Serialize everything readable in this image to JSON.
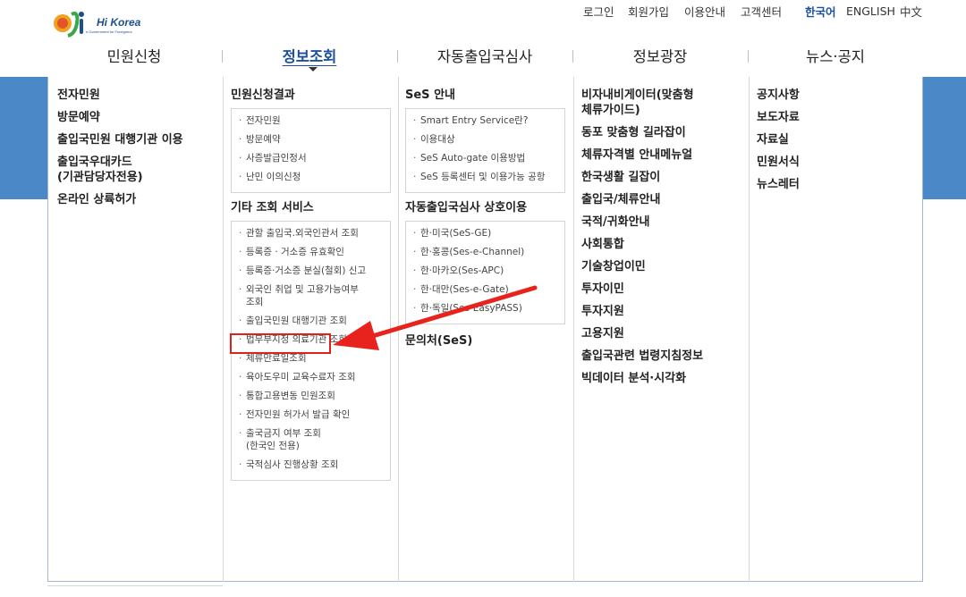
{
  "logo": {
    "text": "Hi Korea",
    "subtext": "e-Government for Foreigners"
  },
  "utility_nav": [
    {
      "label": "로그인",
      "active": false
    },
    {
      "label": "회원가입",
      "active": false
    },
    {
      "label": "이용안내",
      "active": false
    },
    {
      "label": "고객센터",
      "active": false
    },
    {
      "label": "한국어",
      "active": true
    },
    {
      "label": "ENGLISH",
      "active": false
    },
    {
      "label": "中文",
      "active": false
    }
  ],
  "main_nav": [
    {
      "label": "민원신청",
      "active": false
    },
    {
      "label": "정보조회",
      "active": true
    },
    {
      "label": "자동출입국심사",
      "active": false
    },
    {
      "label": "정보광장",
      "active": false
    },
    {
      "label": "뉴스·공지",
      "active": false
    }
  ],
  "col1": [
    {
      "label": "전자민원"
    },
    {
      "label": "방문예약"
    },
    {
      "label": "출입국민원 대행기관 이용"
    },
    {
      "label": "출입국우대카드\n(기관담당자전용)"
    },
    {
      "label": "온라인 상륙허가"
    }
  ],
  "col2": {
    "section1": {
      "title": "민원신청결과",
      "items": [
        "전자민원",
        "방문예약",
        "사증발급인정서",
        "난민 이의신청"
      ]
    },
    "section2": {
      "title": "기타 조회 서비스",
      "items": [
        "관할 출입국.외국인관서 조회",
        "등록증 · 거소증 유효확인",
        "등록증·거소증 분실(철회) 신고",
        "외국인 취업 및 고용가능여부\n조회",
        "출입국민원 대행기관 조회",
        "법무부지정 의료기관 조회",
        "체류만료일조회",
        "육아도우미 교육수료자 조회",
        "통합고용변동 민원조회",
        "전자민원 허가서 발급 확인",
        "출국금지 여부 조회\n(한국인 전용)",
        "국적심사 진행상황 조회"
      ]
    }
  },
  "col3": {
    "section1": {
      "title": "SeS 안내",
      "items": [
        "Smart Entry Service란?",
        "이용대상",
        "SeS Auto-gate 이용방법",
        "SeS 등록센터 및 이용가능 공항"
      ]
    },
    "section2": {
      "title": "자동출입국심사 상호이용",
      "items": [
        "한·미국(SeS-GE)",
        "한·홍콩(Ses-e-Channel)",
        "한·마카오(Ses-APC)",
        "한·대만(Ses-e-Gate)",
        "한·독일(Ses-EasyPASS)"
      ]
    },
    "extra": "문의처(SeS)"
  },
  "col4": [
    {
      "label": "비자내비게이터(맞춤형\n체류가이드)"
    },
    {
      "label": "동포 맞춤형 길라잡이"
    },
    {
      "label": "체류자격별 안내메뉴얼"
    },
    {
      "label": "한국생활 길잡이"
    },
    {
      "label": "출입국/체류안내"
    },
    {
      "label": "국적/귀화안내"
    },
    {
      "label": "사회통합"
    },
    {
      "label": "기술창업이민"
    },
    {
      "label": "투자이민"
    },
    {
      "label": "투자지원"
    },
    {
      "label": "고용지원"
    },
    {
      "label": "출입국관련 법령지침정보"
    },
    {
      "label": "빅데이터 분석·시각화"
    }
  ],
  "col5": [
    {
      "label": "공지사항"
    },
    {
      "label": "보도자료"
    },
    {
      "label": "자료실"
    },
    {
      "label": "민원서식"
    },
    {
      "label": "뉴스레터"
    }
  ],
  "colors": {
    "band": "#4a88c8",
    "active_nav": "#1d4f9c",
    "highlight": "#e0201b"
  },
  "annotation": {
    "highlighted_item": "체류만료일조회"
  }
}
